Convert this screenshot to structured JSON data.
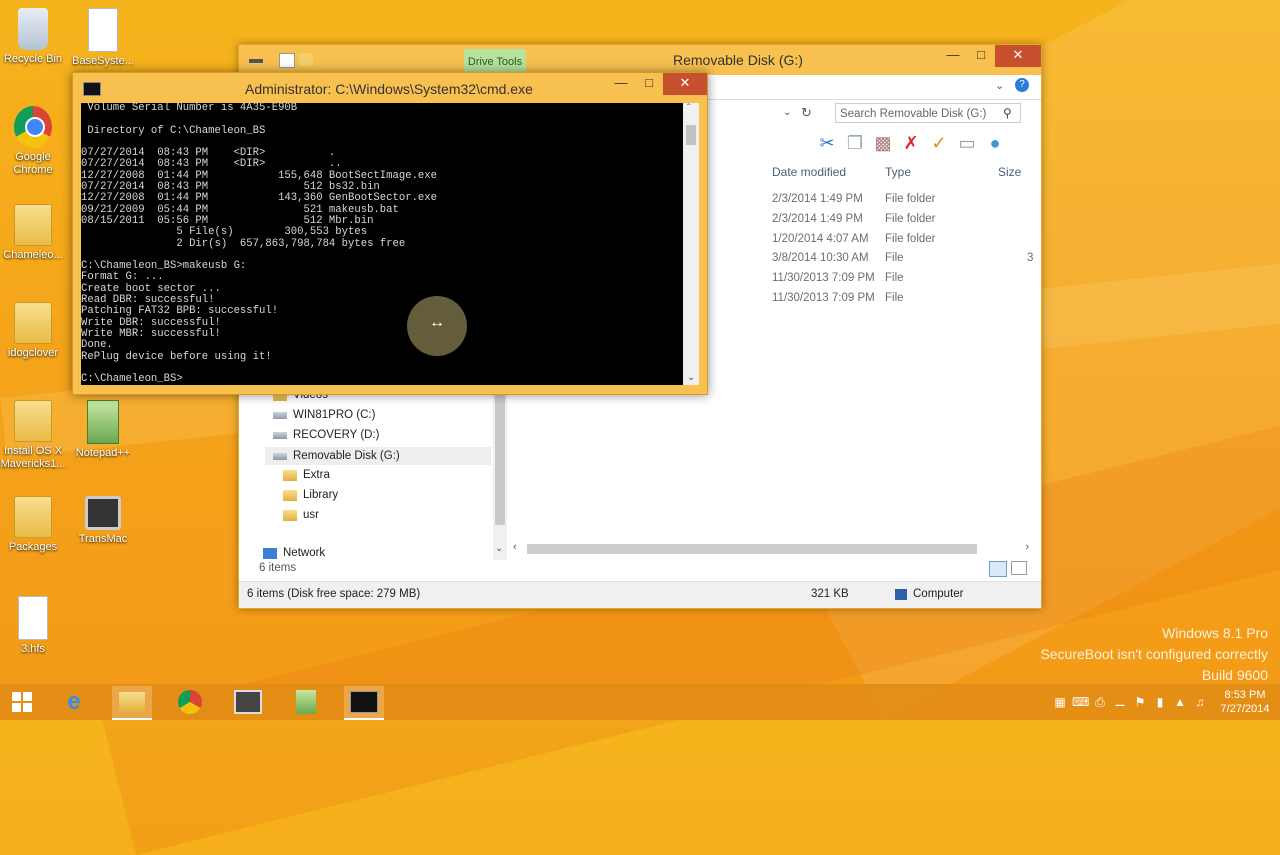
{
  "desktop": {
    "icons": [
      {
        "label": "Recycle Bin",
        "icon": "recycle-bin-icon"
      },
      {
        "label": "BaseSyste...",
        "icon": "file-icon"
      },
      {
        "label": "Google Chrome",
        "icon": "chrome-icon"
      },
      {
        "label": "Chameleo...",
        "icon": "folder-icon"
      },
      {
        "label": "idogclover",
        "icon": "folder-icon"
      },
      {
        "label": "Install OS X Mavericks1...",
        "icon": "folder-icon"
      },
      {
        "label": "Notepad++",
        "icon": "notepad-plus-icon"
      },
      {
        "label": "Packages",
        "icon": "folder-icon"
      },
      {
        "label": "TransMac",
        "icon": "transmac-icon"
      },
      {
        "label": "3.hfs",
        "icon": "file-icon"
      }
    ],
    "watermark": {
      "line1": "Windows 8.1 Pro",
      "line2": "SecureBoot isn't configured correctly",
      "line3": "Build 9600"
    }
  },
  "explorer": {
    "title": "Removable Disk (G:)",
    "contextual_tab": "Drive Tools",
    "search_placeholder": "Search Removable Disk (G:)",
    "columns": {
      "date": "Date modified",
      "type": "Type",
      "size": "Size"
    },
    "rows": [
      {
        "date": "2/3/2014 1:49 PM",
        "type": "File folder",
        "size": ""
      },
      {
        "date": "2/3/2014 1:49 PM",
        "type": "File folder",
        "size": ""
      },
      {
        "date": "1/20/2014 4:07 AM",
        "type": "File folder",
        "size": ""
      },
      {
        "date": "3/8/2014 10:30 AM",
        "type": "File",
        "size": "3"
      },
      {
        "date": "11/30/2013 7:09 PM",
        "type": "File",
        "size": ""
      },
      {
        "date": "11/30/2013 7:09 PM",
        "type": "File",
        "size": ""
      }
    ],
    "nav": {
      "videos": "Videos",
      "c_drive": "WIN81PRO (C:)",
      "d_drive": "RECOVERY (D:)",
      "g_drive": "Removable Disk (G:)",
      "extra": "Extra",
      "library": "Library",
      "usr": "usr",
      "network": "Network"
    },
    "item_count": "6 items",
    "status": {
      "items": "6 items (Disk free space: 279 MB)",
      "size": "321 KB",
      "location": "Computer"
    }
  },
  "cmd": {
    "title": "Administrator: C:\\Windows\\System32\\cmd.exe",
    "console_text": " Volume Serial Number is 4A35-E90B\n\n Directory of C:\\Chameleon_BS\n\n07/27/2014  08:43 PM    <DIR>          .\n07/27/2014  08:43 PM    <DIR>          ..\n12/27/2008  01:44 PM           155,648 BootSectImage.exe\n07/27/2014  08:43 PM               512 bs32.bin\n12/27/2008  01:44 PM           143,360 GenBootSector.exe\n09/21/2009  05:44 PM               521 makeusb.bat\n08/15/2011  05:56 PM               512 Mbr.bin\n               5 File(s)        300,553 bytes\n               2 Dir(s)  657,863,798,784 bytes free\n\nC:\\Chameleon_BS>makeusb G:\nFormat G: ...\nCreate boot sector ...\nRead DBR: successful!\nPatching FAT32 BPB: successful!\nWrite DBR: successful!\nWrite MBR: successful!\nDone.\nRePlug device before using it!\n\nC:\\Chameleon_BS>"
  },
  "taskbar": {
    "clock_time": "8:53 PM",
    "clock_date": "7/27/2014"
  }
}
